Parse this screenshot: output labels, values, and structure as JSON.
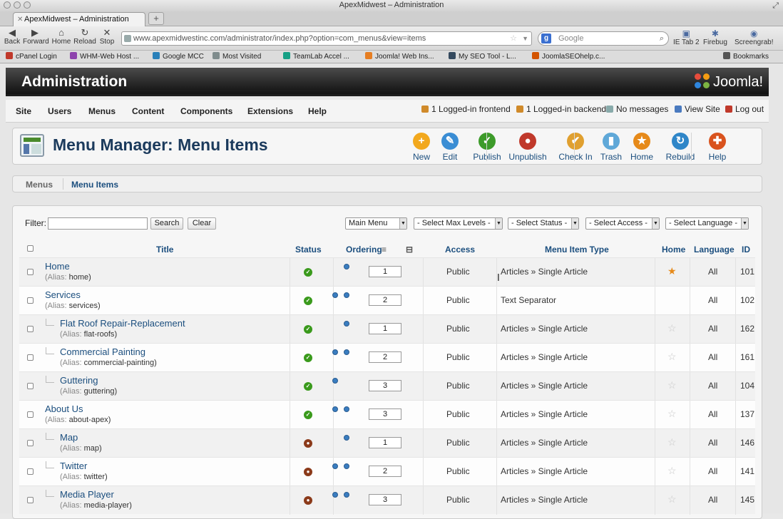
{
  "window": {
    "title": "ApexMidwest – Administration"
  },
  "browser": {
    "tab_title": "ApexMidwest – Administration",
    "new_tab": "+",
    "nav": [
      {
        "label": "Back",
        "glyph": "◀"
      },
      {
        "label": "Forward",
        "glyph": "▶"
      },
      {
        "label": "Home",
        "glyph": "⌂"
      },
      {
        "label": "Reload",
        "glyph": "↻"
      },
      {
        "label": "Stop",
        "glyph": "✕"
      }
    ],
    "url": "www.apexmidwestinc.com/administrator/index.php?option=com_menus&view=items",
    "search_placeholder": "Google",
    "extensions": [
      {
        "label": "IE Tab 2",
        "glyph": "▣"
      },
      {
        "label": "Firebug",
        "glyph": "✱"
      },
      {
        "label": "Screengrab!",
        "glyph": "◉"
      }
    ],
    "bookmarks": [
      {
        "label": "cPanel Login",
        "color": "#c0392b"
      },
      {
        "label": "WHM-Web Host ...",
        "color": "#8e44ad"
      },
      {
        "label": "Google MCC",
        "color": "#2980b9"
      },
      {
        "label": "Most Visited",
        "color": "#7f8c8d"
      },
      {
        "label": "TeamLab Accel ...",
        "color": "#16a085"
      },
      {
        "label": "Joomla! Web Ins...",
        "color": "#e67e22"
      },
      {
        "label": "My SEO Tool - L...",
        "color": "#34495e"
      },
      {
        "label": "JoomlaSEOhelp.c...",
        "color": "#d35400"
      },
      {
        "label": "Bookmarks",
        "color": "#555555"
      }
    ]
  },
  "admin": {
    "title": "Administration",
    "logo": "Joomla!",
    "menu": [
      "Site",
      "Users",
      "Menus",
      "Content",
      "Components",
      "Extensions",
      "Help"
    ],
    "status": [
      {
        "label": "1 Logged-in frontend",
        "icon": "users-icon"
      },
      {
        "label": "1 Logged-in backend",
        "icon": "users-icon"
      },
      {
        "label": "No messages",
        "icon": "mail-icon"
      },
      {
        "label": "View Site",
        "icon": "monitor-icon"
      },
      {
        "label": "Log out",
        "icon": "logout-icon"
      }
    ]
  },
  "toolbar": {
    "title": "Menu Manager: Menu Items",
    "buttons": [
      {
        "label": "New",
        "glyph": "+",
        "color": "#f2a81d"
      },
      {
        "label": "Edit",
        "glyph": "✎",
        "color": "#3a8dd4"
      },
      {
        "label": "Publish",
        "glyph": "✓",
        "color": "#3d9b2a"
      },
      {
        "label": "Unpublish",
        "glyph": "●",
        "color": "#c0392b"
      },
      {
        "label": "Check In",
        "glyph": "✔",
        "color": "#e0a030"
      },
      {
        "label": "Trash",
        "glyph": "▮",
        "color": "#5fa8d8"
      },
      {
        "label": "Home",
        "glyph": "★",
        "color": "#e68a1a"
      },
      {
        "label": "Rebuild",
        "glyph": "↻",
        "color": "#2f86c8"
      },
      {
        "label": "Help",
        "glyph": "✚",
        "color": "#d9531e"
      }
    ]
  },
  "subnav": {
    "menus": "Menus",
    "items": "Menu Items"
  },
  "filter": {
    "label": "Filter:",
    "value": "",
    "search": "Search",
    "clear": "Clear",
    "selects": [
      "Main Menu",
      "- Select Max Levels -",
      "- Select Status -",
      "- Select Access -",
      "- Select Language -"
    ]
  },
  "table": {
    "headers": {
      "title": "Title",
      "status": "Status",
      "ordering": "Ordering",
      "access": "Access",
      "type": "Menu Item Type",
      "home": "Home",
      "language": "Language",
      "id": "ID"
    },
    "alias_label": "Alias:",
    "rows": [
      {
        "title": "Home",
        "alias": "home",
        "level": 1,
        "published": true,
        "up": false,
        "down": true,
        "order": "1",
        "access": "Public",
        "type": "Articles » Single Article",
        "home": true,
        "language": "All",
        "id": "101"
      },
      {
        "title": "Services",
        "alias": "services",
        "level": 1,
        "published": true,
        "up": true,
        "down": true,
        "order": "2",
        "access": "Public",
        "type": "Text Separator",
        "home": null,
        "language": "All",
        "id": "102"
      },
      {
        "title": "Flat Roof Repair-Replacement",
        "alias": "flat-roofs",
        "level": 2,
        "published": true,
        "up": false,
        "down": true,
        "order": "1",
        "access": "Public",
        "type": "Articles » Single Article",
        "home": false,
        "language": "All",
        "id": "162"
      },
      {
        "title": "Commercial Painting",
        "alias": "commercial-painting",
        "level": 2,
        "published": true,
        "up": true,
        "down": true,
        "order": "2",
        "access": "Public",
        "type": "Articles » Single Article",
        "home": false,
        "language": "All",
        "id": "161"
      },
      {
        "title": "Guttering",
        "alias": "guttering",
        "level": 2,
        "published": true,
        "up": true,
        "down": false,
        "order": "3",
        "access": "Public",
        "type": "Articles » Single Article",
        "home": false,
        "language": "All",
        "id": "104"
      },
      {
        "title": "About Us",
        "alias": "about-apex",
        "level": 1,
        "published": true,
        "up": true,
        "down": true,
        "order": "3",
        "access": "Public",
        "type": "Articles » Single Article",
        "home": false,
        "language": "All",
        "id": "137"
      },
      {
        "title": "Map",
        "alias": "map",
        "level": 2,
        "published": false,
        "up": false,
        "down": true,
        "order": "1",
        "access": "Public",
        "type": "Articles » Single Article",
        "home": false,
        "language": "All",
        "id": "146"
      },
      {
        "title": "Twitter",
        "alias": "twitter",
        "level": 2,
        "published": false,
        "up": true,
        "down": true,
        "order": "2",
        "access": "Public",
        "type": "Articles » Single Article",
        "home": false,
        "language": "All",
        "id": "141"
      },
      {
        "title": "Media Player",
        "alias": "media-player",
        "level": 2,
        "published": false,
        "up": true,
        "down": true,
        "order": "3",
        "access": "Public",
        "type": "Articles » Single Article",
        "home": false,
        "language": "All",
        "id": "145"
      }
    ]
  },
  "colors": {
    "link": "#1b4e7e",
    "published": "#3a9a1c",
    "unpublished": "#8b3a1a",
    "home_star": "#e68a1a"
  }
}
